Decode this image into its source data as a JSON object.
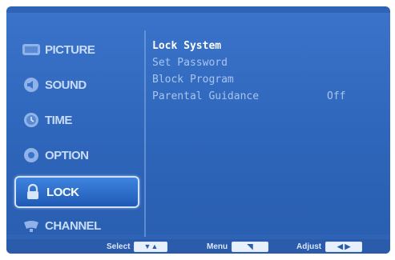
{
  "sidebar": {
    "items": [
      {
        "label": "PICTURE",
        "icon": "picture-icon"
      },
      {
        "label": "SOUND",
        "icon": "sound-icon"
      },
      {
        "label": "TIME",
        "icon": "time-icon"
      },
      {
        "label": "OPTION",
        "icon": "option-icon"
      },
      {
        "label": "LOCK",
        "icon": "lock-icon",
        "selected": true
      },
      {
        "label": "CHANNEL",
        "icon": "channel-icon"
      }
    ]
  },
  "content": {
    "title": "Lock System",
    "items": [
      {
        "label": "Set Password",
        "value": ""
      },
      {
        "label": "Block Program",
        "value": ""
      },
      {
        "label": "Parental Guidance",
        "value": "Off"
      }
    ]
  },
  "footer": {
    "select_label": "Select",
    "menu_label": "Menu",
    "adjust_label": "Adjust"
  },
  "colors": {
    "panel": "#2f63b6",
    "selected": "#1f5ab5",
    "text": "#c9dcf7"
  }
}
